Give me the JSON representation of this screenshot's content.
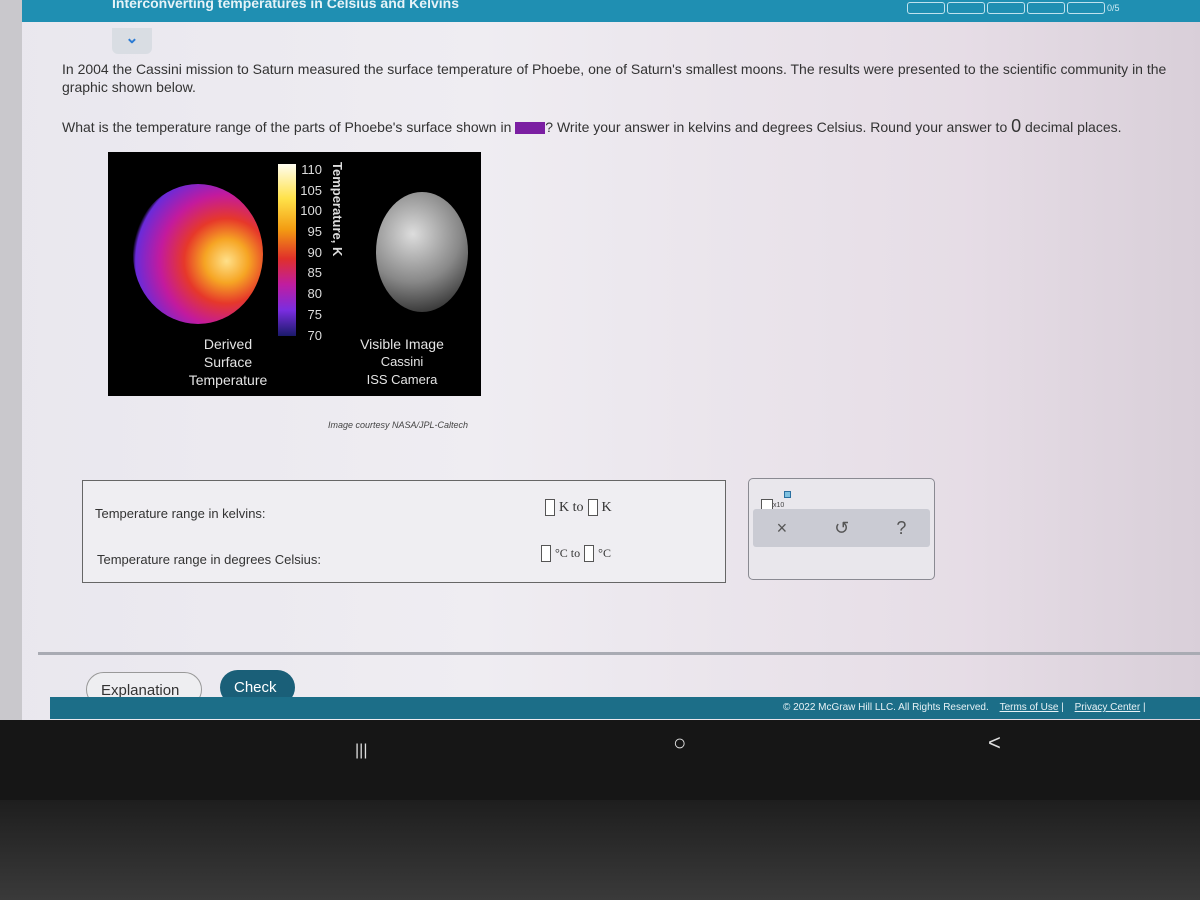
{
  "header": {
    "title": "Interconverting temperatures in Celsius and Kelvins",
    "progress": "0/5",
    "progress_fraction": 0,
    "color": "#1f8fb2"
  },
  "question": {
    "intro": "In 2004 the Cassini mission to Saturn measured the surface temperature of Phoebe, one of Saturn's smallest moons. The results were presented to the scientific community in the graphic shown below.",
    "prompt_before": "What is the temperature range of the parts of Phoebe's surface shown in",
    "prompt_after": "? Write your answer in kelvins and degrees Celsius. Round your answer to",
    "decimals": "0",
    "prompt_end": "decimal places.",
    "swatch_color": "#7b1fa2"
  },
  "figure": {
    "colorbar_ticks": [
      "110",
      "105",
      "100",
      "95",
      "90",
      "85",
      "80",
      "75",
      "70"
    ],
    "axis_label": "Temperature, K",
    "left_label": [
      "Derived",
      "Surface",
      "Temperature"
    ],
    "right_label": [
      "Visible Image",
      "Cassini",
      "ISS Camera"
    ],
    "credit": "Image courtesy NASA/JPL-Caltech"
  },
  "answer": {
    "kelvin_label": "Temperature range in kelvins:",
    "celsius_label": "Temperature range in degrees Celsius:",
    "k_to": "K to",
    "k_unit": "K",
    "c_to": "°C to",
    "c_unit": "°C",
    "kelvin_low": "",
    "kelvin_high": "",
    "celsius_low": "",
    "celsius_high": ""
  },
  "tools": {
    "sci_notation": "x10",
    "clear": "×",
    "undo": "↺",
    "help": "?"
  },
  "buttons": {
    "explanation": "Explanation",
    "check": "Check"
  },
  "footer": {
    "copyright": "© 2022 McGraw Hill LLC. All Rights Reserved.",
    "terms": "Terms of Use",
    "privacy": "Privacy Center"
  },
  "android_nav": {
    "recents": "|||",
    "home": "○",
    "back": "<"
  }
}
